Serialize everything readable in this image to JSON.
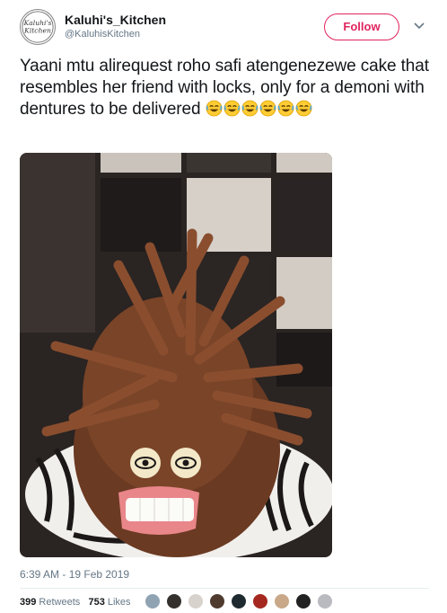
{
  "account": {
    "name": "Kaluhi's_Kitchen",
    "handle": "@KaluhisKitchen",
    "avatar_text_1": "Kaluhi's",
    "avatar_text_2": "Kitchen"
  },
  "follow_label": "Follow",
  "tweet": {
    "text": "Yaani mtu alirequest roho safi atengenezewe cake that resembles her friend with locks, only for a demoni with dentures to be delivered",
    "emoji_icon": "rolling-on-floor-laughing-emoji",
    "emoji_count": 6
  },
  "timestamp": "6:39 AM - 19 Feb 2019",
  "stats": {
    "retweets_count": "399",
    "retweets_label": "Retweets",
    "likes_count": "753",
    "likes_label": "Likes"
  },
  "colors": {
    "accent": "#e0245e",
    "text": "#14171a",
    "secondary": "#657786"
  }
}
